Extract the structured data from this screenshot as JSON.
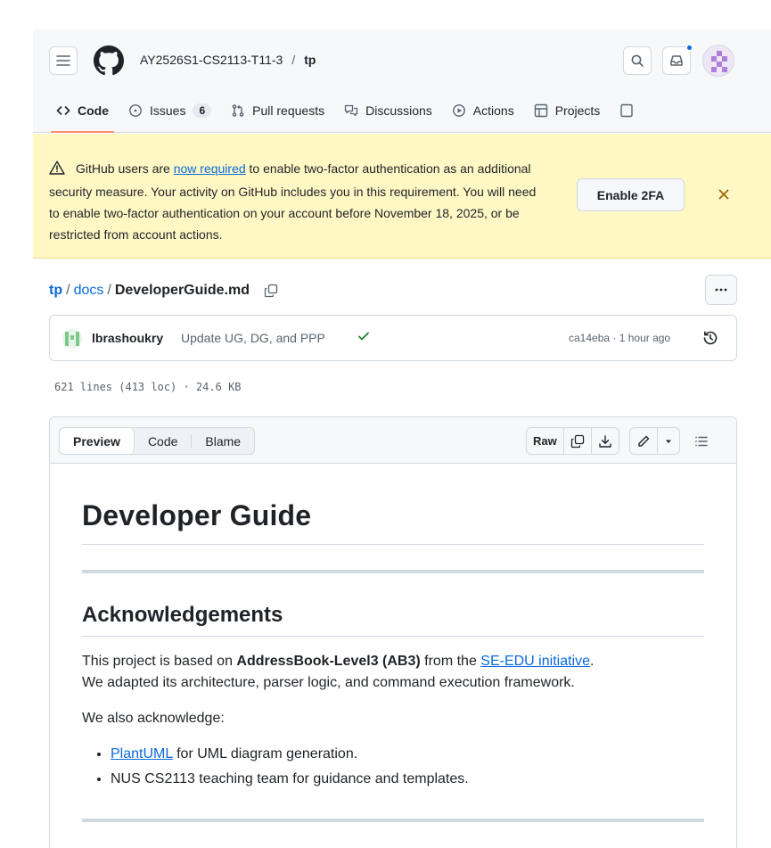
{
  "header": {
    "owner": "AY2526S1-CS2113-T11-3",
    "separator": "/",
    "repo": "tp"
  },
  "tabs": [
    {
      "label": "Code",
      "icon": "code-icon"
    },
    {
      "label": "Issues",
      "count": "6",
      "icon": "issue-icon"
    },
    {
      "label": "Pull requests",
      "icon": "pull-request-icon"
    },
    {
      "label": "Discussions",
      "icon": "discussions-icon"
    },
    {
      "label": "Actions",
      "icon": "play-icon"
    },
    {
      "label": "Projects",
      "icon": "table-icon"
    }
  ],
  "banner": {
    "text_before": "GitHub users are ",
    "link": "now required",
    "text_after": " to enable two-factor authentication as an additional security measure. Your activity on GitHub includes you in this requirement. You will need to enable two-factor authentication on your account before November 18, 2025, or be restricted from account actions.",
    "button": "Enable 2FA",
    "close": "×"
  },
  "path": {
    "root": "tp",
    "folder": "docs",
    "file": "DeveloperGuide.md",
    "sep": "/"
  },
  "commit": {
    "author": "lbrashoukry",
    "message": "Update UG, DG, and PPP",
    "hash": "ca14eba",
    "time": "1 hour ago",
    "meta_sep": " · "
  },
  "file_stats": "621 lines (413 loc) · 24.6 KB",
  "toolbar": {
    "preview": "Preview",
    "code": "Code",
    "blame": "Blame",
    "raw": "Raw"
  },
  "doc": {
    "h1": "Developer Guide",
    "h2": "Acknowledgements",
    "p1_before": "This project is based on ",
    "p1_bold": "AddressBook-Level3 (AB3)",
    "p1_mid": " from the ",
    "p1_link": "SE-EDU initiative",
    "p1_after": ".",
    "p1_line2": "We adapted its architecture, parser logic, and command execution framework.",
    "p2": "We also acknowledge:",
    "li1_link": "PlantUML",
    "li1_after": " for UML diagram generation.",
    "li2": "NUS CS2113 teaching team for guidance and templates."
  },
  "colors": {
    "accent": "#0969da",
    "banner_bg": "#fff8c5",
    "tab_underline": "#fd8c73",
    "success": "#1a7f37"
  }
}
